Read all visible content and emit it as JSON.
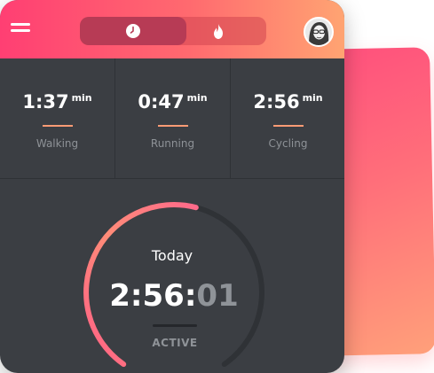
{
  "header": {
    "menu_icon": "hamburger-menu-icon",
    "tabs": [
      {
        "icon": "clock-icon",
        "selected": true
      },
      {
        "icon": "flame-icon",
        "selected": false
      }
    ],
    "avatar_icon": "user-avatar",
    "accent": "#ff4f7d"
  },
  "stats": [
    {
      "value": "1:37",
      "unit": "min",
      "label": "Walking"
    },
    {
      "value": "0:47",
      "unit": "min",
      "label": "Running"
    },
    {
      "value": "2:56",
      "unit": "min",
      "label": "Cycling"
    }
  ],
  "timer": {
    "title": "Today",
    "time_main": "2:56:",
    "time_seconds": "01",
    "status": "ACTIVE",
    "progress": 0.55
  }
}
